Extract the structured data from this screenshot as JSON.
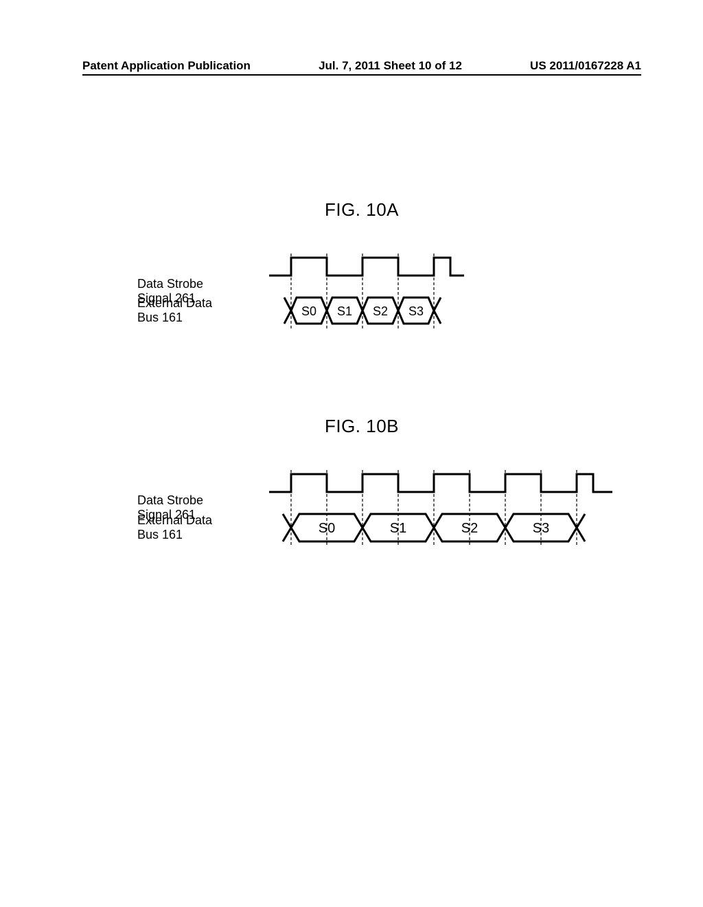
{
  "header": {
    "left": "Patent Application Publication",
    "mid": "Jul. 7, 2011   Sheet 10 of 12",
    "right": "US 2011/0167228 A1"
  },
  "figA": {
    "title": "FIG. 10A",
    "strobe_label_l1": "Data Strobe",
    "strobe_label_l2": "Signal 261",
    "bus_label_l1": "External Data",
    "bus_label_l2": "Bus 161",
    "cells": [
      "S0",
      "S1",
      "S2",
      "S3"
    ]
  },
  "figB": {
    "title": "FIG. 10B",
    "strobe_label_l1": "Data Strobe",
    "strobe_label_l2": "Signal 261",
    "bus_label_l1": "External Data",
    "bus_label_l2": "Bus 161",
    "cells": [
      "S0",
      "S1",
      "S2",
      "S3"
    ]
  }
}
